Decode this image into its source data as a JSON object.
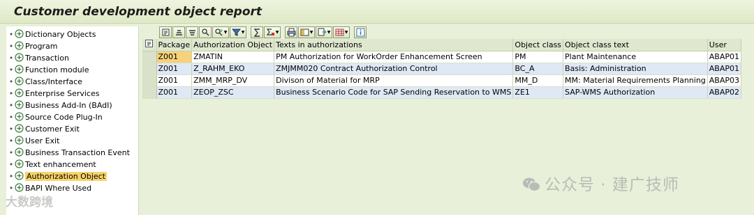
{
  "report": {
    "title": "Customer development object report"
  },
  "tree": {
    "items": [
      {
        "label": "Dictionary Objects"
      },
      {
        "label": "Program"
      },
      {
        "label": "Transaction"
      },
      {
        "label": "Function module"
      },
      {
        "label": "Class/Interface"
      },
      {
        "label": "Enterprise Services"
      },
      {
        "label": "Business Add-In (BAdI)"
      },
      {
        "label": "Source Code Plug-In"
      },
      {
        "label": "Customer Exit"
      },
      {
        "label": "User Exit"
      },
      {
        "label": "Business Transaction Event"
      },
      {
        "label": "Text enhancement"
      },
      {
        "label": "Authorization Object",
        "selected": true
      },
      {
        "label": "BAPI Where Used"
      }
    ]
  },
  "toolbar": {
    "buttons": [
      "details-icon",
      "sort-ascending-icon",
      "sort-descending-icon",
      "find-icon",
      "find-next-icon",
      "filter-icon",
      "sum-icon",
      "subtotal-icon",
      "print-icon",
      "views-icon",
      "export-icon",
      "layout-icon",
      "info-icon"
    ]
  },
  "table": {
    "columns": [
      "Package",
      "Authorization Object",
      "Texts in authorizations",
      "Object class",
      "Object class text",
      "User"
    ],
    "rows": [
      {
        "package": "Z001",
        "auth_object": "ZMATIN",
        "text": "PM Authorization for WorkOrder Enhancement Screen",
        "object_class": "PM",
        "class_text": "Plant Maintenance",
        "user": "ABAP01"
      },
      {
        "package": "Z001",
        "auth_object": "Z_RAHM_EKO",
        "text": "ZMJMM020 Contract Authorization Control",
        "object_class": "BC_A",
        "class_text": "Basis: Administration",
        "user": "ABAP01"
      },
      {
        "package": "Z001",
        "auth_object": "ZMM_MRP_DV",
        "text": "Divison of Material for MRP",
        "object_class": "MM_D",
        "class_text": "MM: Material Requirements Planning",
        "user": "ABAP03"
      },
      {
        "package": "Z001",
        "auth_object": "ZEOP_ZSC",
        "text": "Business Scenario Code for SAP Sending  Reservation to WMS",
        "object_class": "ZE1",
        "class_text": "SAP-WMS Authorization",
        "user": "ABAP02"
      }
    ]
  },
  "watermark": {
    "text": "公众号 · 建广技师",
    "text2": "大数跨境"
  }
}
